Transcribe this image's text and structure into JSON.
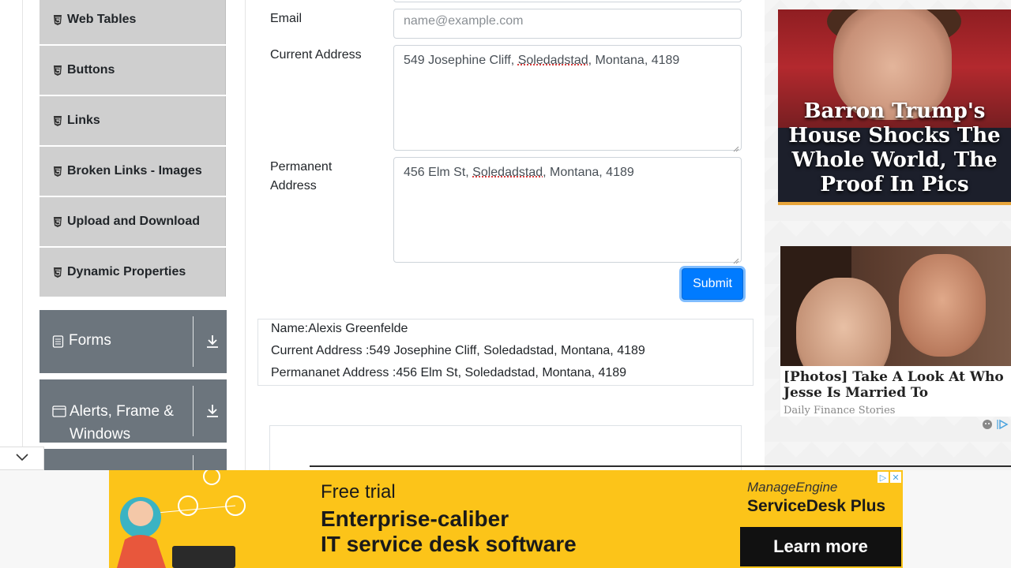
{
  "sidebar": {
    "items": [
      {
        "label": "Web Tables"
      },
      {
        "label": "Buttons"
      },
      {
        "label": "Links"
      },
      {
        "label": "Broken Links - Images"
      },
      {
        "label": "Upload and Download"
      },
      {
        "label": "Dynamic Properties"
      }
    ],
    "groups": [
      {
        "label": "Forms",
        "icon": "form-icon"
      },
      {
        "label": "Alerts, Frame & Windows",
        "line1": "Alerts, Frame &",
        "line2": "Windows",
        "icon": "window-icon"
      }
    ]
  },
  "form": {
    "email_label": "Email",
    "email_placeholder": "name@example.com",
    "current_address_label": "Current Address",
    "current_address_parts": [
      "549 Josephine Cliff, ",
      "Soledadstad",
      ", Montana, 4189"
    ],
    "permanent_address_label_1": "Permanent",
    "permanent_address_label_2": "Address",
    "permanent_address_parts": [
      "456 Elm St, ",
      "Soledadstad",
      ", Montana, 4189"
    ],
    "submit_label": "Submit"
  },
  "output": {
    "name": "Name:Alexis Greenfelde",
    "current_address": "Current Address :549 Josephine Cliff, Soledadstad, Montana, 4189",
    "permanent_address": "Permananet Address :456 Elm St, Soledadstad, Montana, 4189"
  },
  "ads": {
    "ad1_headline": "Barron Trump's House Shocks The Whole World, The Proof In Pics",
    "ad2_title": "[Photos] Take A Look At Who Jesse Is Married To",
    "ad2_source": "Daily Finance Stories"
  },
  "banner": {
    "line1": "Free trial",
    "line2": "Enterprise-caliber",
    "line3": "IT service desk software",
    "brand_top": "ManageEngine",
    "brand_name": "ServiceDesk Plus",
    "cta": "Learn more"
  },
  "colors": {
    "primary": "#007bff",
    "sidebar_item_bg": "#cfcfcf",
    "group_bg": "#6c757d",
    "banner_bg": "#fcc419"
  }
}
